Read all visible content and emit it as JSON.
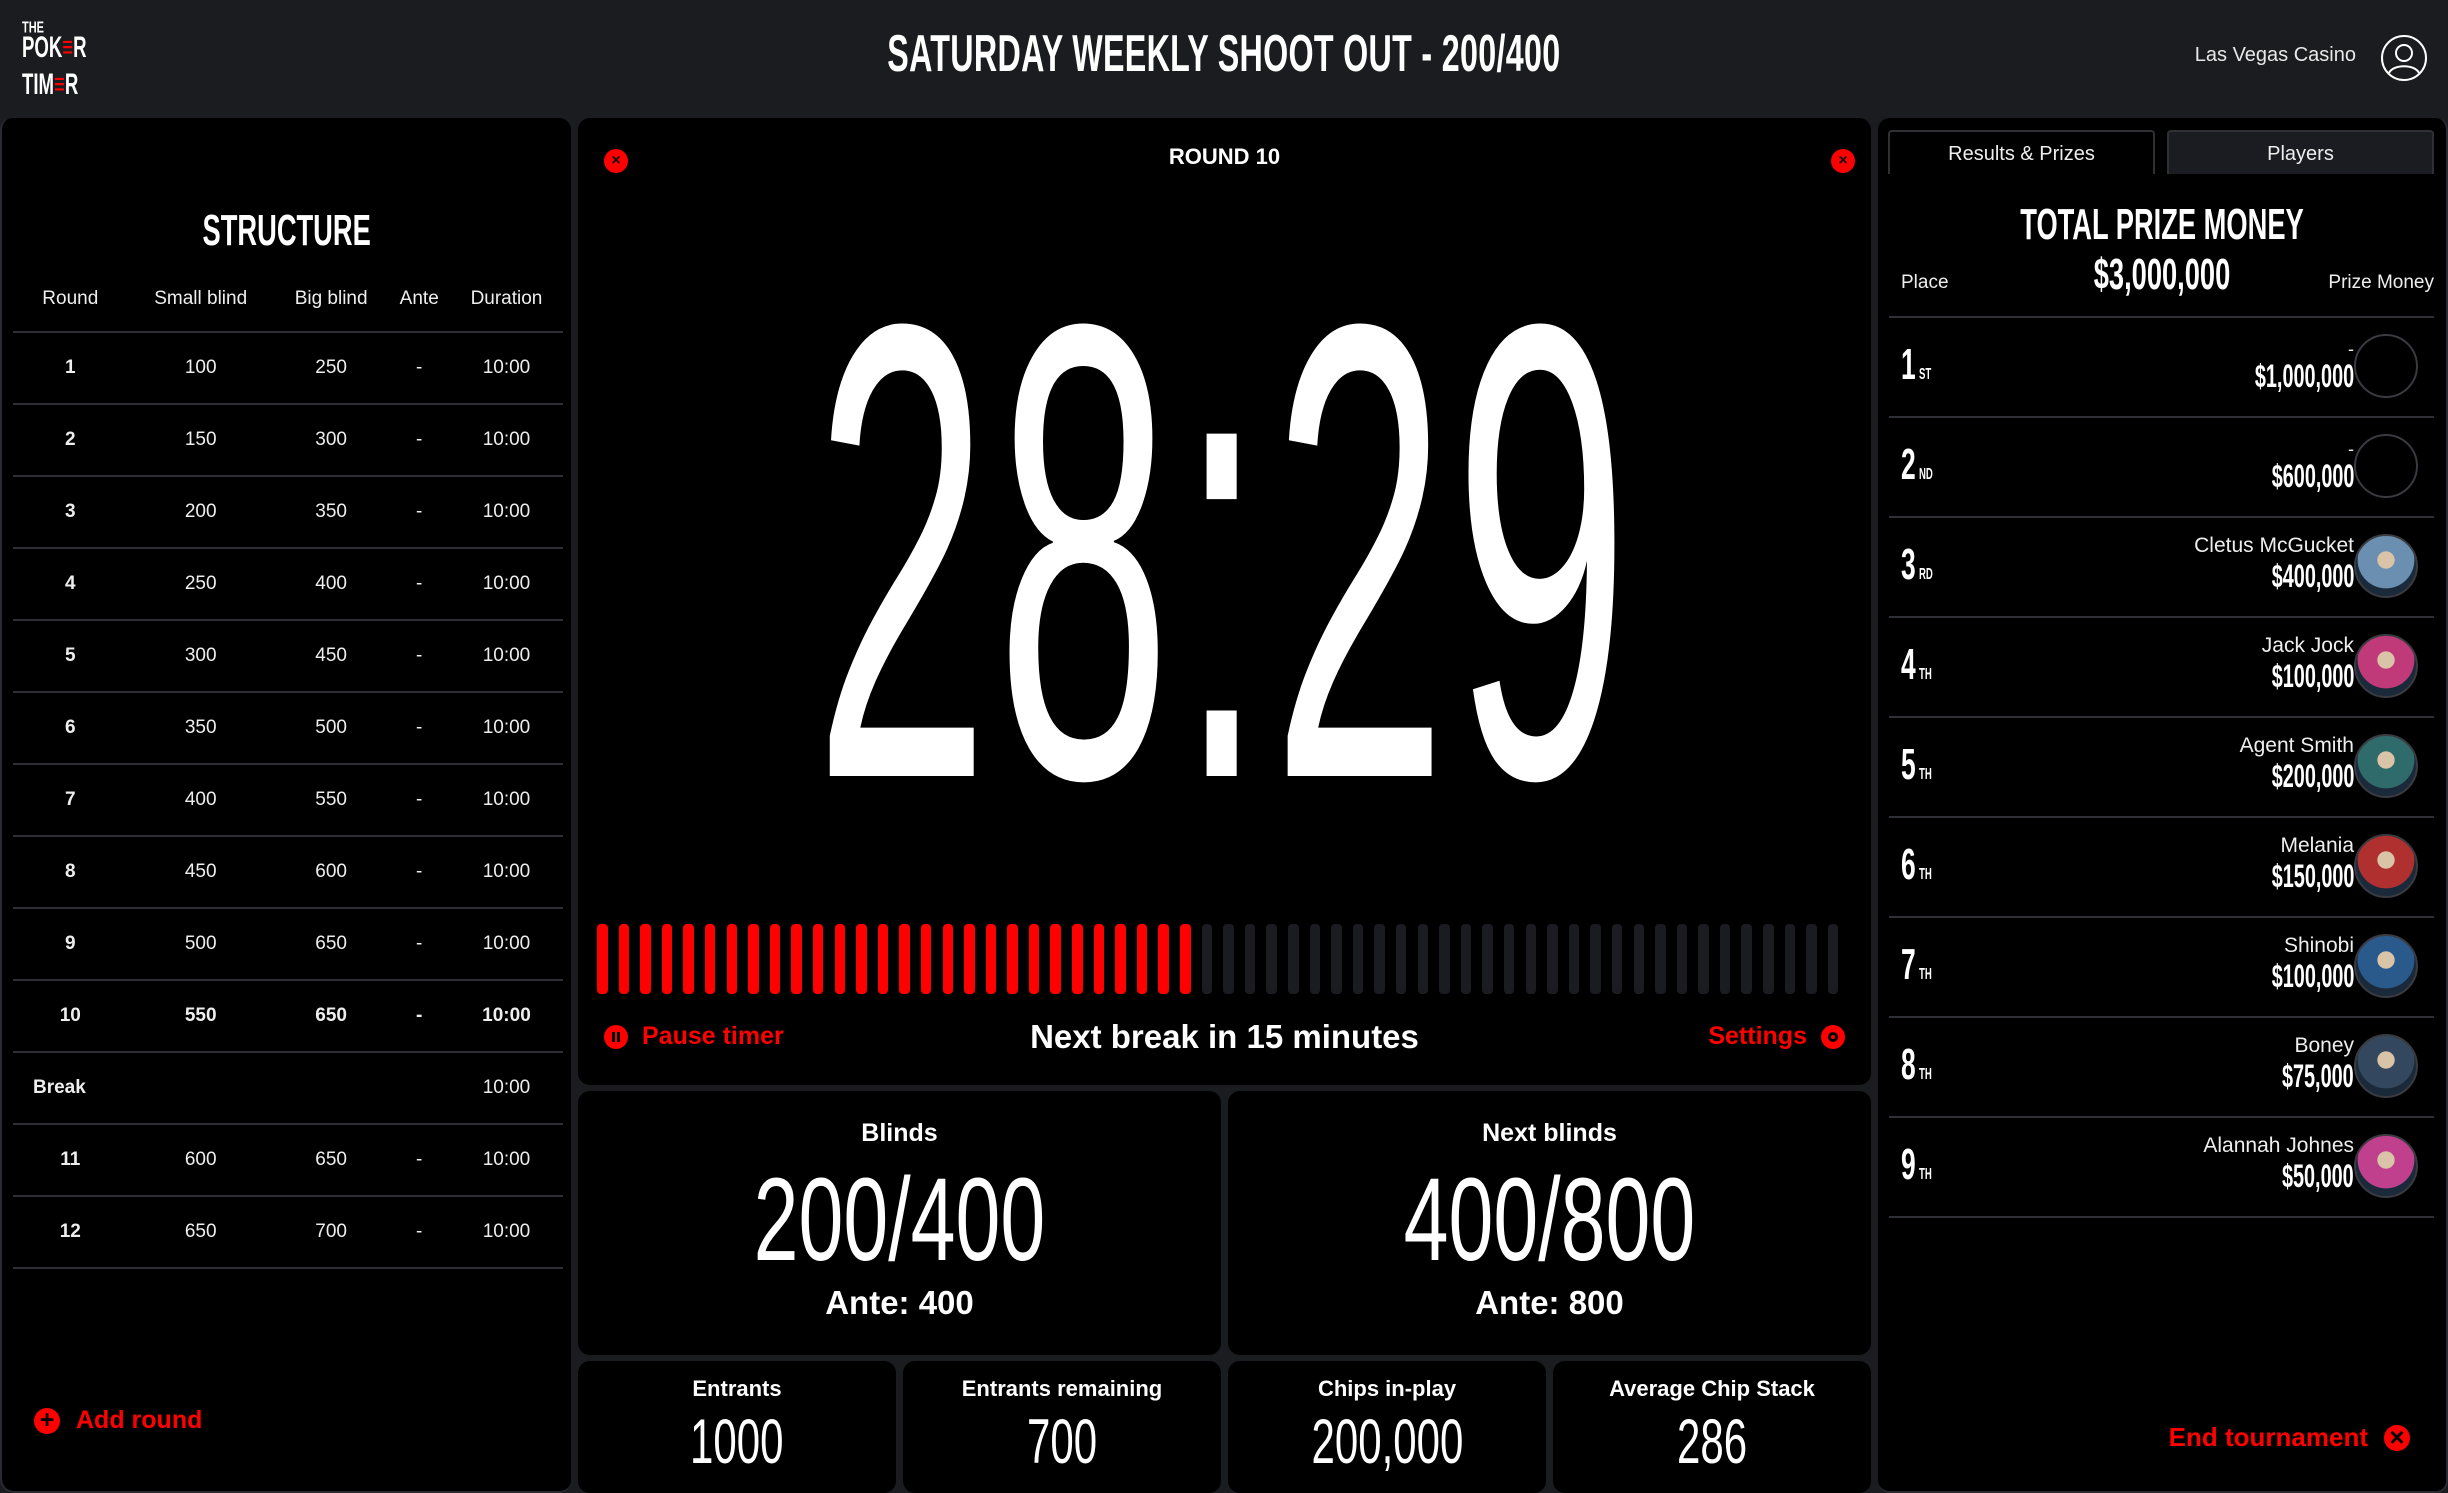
{
  "header": {
    "logo": {
      "the": "THE",
      "line1_a": "POK",
      "line1_b": "≡",
      "line1_c": "R",
      "line2_a": "TIM",
      "line2_b": "≡",
      "line2_c": "R"
    },
    "title": "SATURDAY WEEKLY SHOOT OUT - 200/400",
    "venue": "Las Vegas Casino",
    "account_icon": "user-circle-icon"
  },
  "structure": {
    "title": "STRUCTURE",
    "columns": [
      "Round",
      "Small blind",
      "Big blind",
      "Ante",
      "Duration"
    ],
    "rows": [
      {
        "round": "1",
        "small": "100",
        "big": "250",
        "ante": "-",
        "duration": "10:00"
      },
      {
        "round": "2",
        "small": "150",
        "big": "300",
        "ante": "-",
        "duration": "10:00"
      },
      {
        "round": "3",
        "small": "200",
        "big": "350",
        "ante": "-",
        "duration": "10:00"
      },
      {
        "round": "4",
        "small": "250",
        "big": "400",
        "ante": "-",
        "duration": "10:00"
      },
      {
        "round": "5",
        "small": "300",
        "big": "450",
        "ante": "-",
        "duration": "10:00"
      },
      {
        "round": "6",
        "small": "350",
        "big": "500",
        "ante": "-",
        "duration": "10:00"
      },
      {
        "round": "7",
        "small": "400",
        "big": "550",
        "ante": "-",
        "duration": "10:00"
      },
      {
        "round": "8",
        "small": "450",
        "big": "600",
        "ante": "-",
        "duration": "10:00"
      },
      {
        "round": "9",
        "small": "500",
        "big": "650",
        "ante": "-",
        "duration": "10:00"
      },
      {
        "round": "10",
        "small": "550",
        "big": "650",
        "ante": "-",
        "duration": "10:00",
        "current": true
      },
      {
        "round": "Break",
        "small": "",
        "big": "",
        "ante": "",
        "duration": "10:00",
        "break": true
      },
      {
        "round": "11",
        "small": "600",
        "big": "650",
        "ante": "-",
        "duration": "10:00"
      },
      {
        "round": "12",
        "small": "650",
        "big": "700",
        "ante": "-",
        "duration": "10:00"
      }
    ],
    "add_round_label": "Add round"
  },
  "timer": {
    "round_label": "ROUND 10",
    "time": "28:29",
    "progress": {
      "segments_total": 58,
      "segments_filled": 28,
      "fraction": 0.48
    },
    "pause_label": "Pause timer",
    "next_break": "Next break in 15 minutes",
    "settings_label": "Settings"
  },
  "blinds": {
    "current": {
      "label": "Blinds",
      "value": "200/400",
      "ante": "Ante: 400"
    },
    "next": {
      "label": "Next blinds",
      "value": "400/800",
      "ante": "Ante: 800"
    }
  },
  "stats": [
    {
      "label": "Entrants",
      "value": "1000"
    },
    {
      "label": "Entrants remaining",
      "value": "700"
    },
    {
      "label": "Chips in-play",
      "value": "200,000"
    },
    {
      "label": "Average Chip Stack",
      "value": "286"
    }
  ],
  "results": {
    "tabs": [
      "Results & Prizes",
      "Players"
    ],
    "active_tab": "Results & Prizes",
    "title": "TOTAL PRIZE MONEY $3,000,000",
    "col_place": "Place",
    "col_prize": "Prize Money",
    "rows": [
      {
        "place": "1",
        "suffix": "ST",
        "name": "-",
        "amount": "$1,000,000",
        "avatar": "empty"
      },
      {
        "place": "2",
        "suffix": "ND",
        "name": "-",
        "amount": "$600,000",
        "avatar": "empty"
      },
      {
        "place": "3",
        "suffix": "RD",
        "name": "Cletus McGucket",
        "amount": "$400,000",
        "avatar": "#6a8fb0"
      },
      {
        "place": "4",
        "suffix": "TH",
        "name": "Jack Jock",
        "amount": "$100,000",
        "avatar": "#c03a7a"
      },
      {
        "place": "5",
        "suffix": "TH",
        "name": "Agent Smith",
        "amount": "$200,000",
        "avatar": "#2e6b6a"
      },
      {
        "place": "6",
        "suffix": "TH",
        "name": "Melania",
        "amount": "$150,000",
        "avatar": "#b03030"
      },
      {
        "place": "7",
        "suffix": "TH",
        "name": "Shinobi",
        "amount": "$100,000",
        "avatar": "#2a5a8c"
      },
      {
        "place": "8",
        "suffix": "TH",
        "name": "Boney",
        "amount": "$75,000",
        "avatar": "#33475e"
      },
      {
        "place": "9",
        "suffix": "TH",
        "name": "Alannah Johnes",
        "amount": "$50,000",
        "avatar": "#c0408e"
      }
    ],
    "end_label": "End tournament"
  },
  "colors": {
    "accent": "#ff0000",
    "background": "#000000",
    "chrome": "#1b1c20",
    "divider": "#2f3034"
  }
}
